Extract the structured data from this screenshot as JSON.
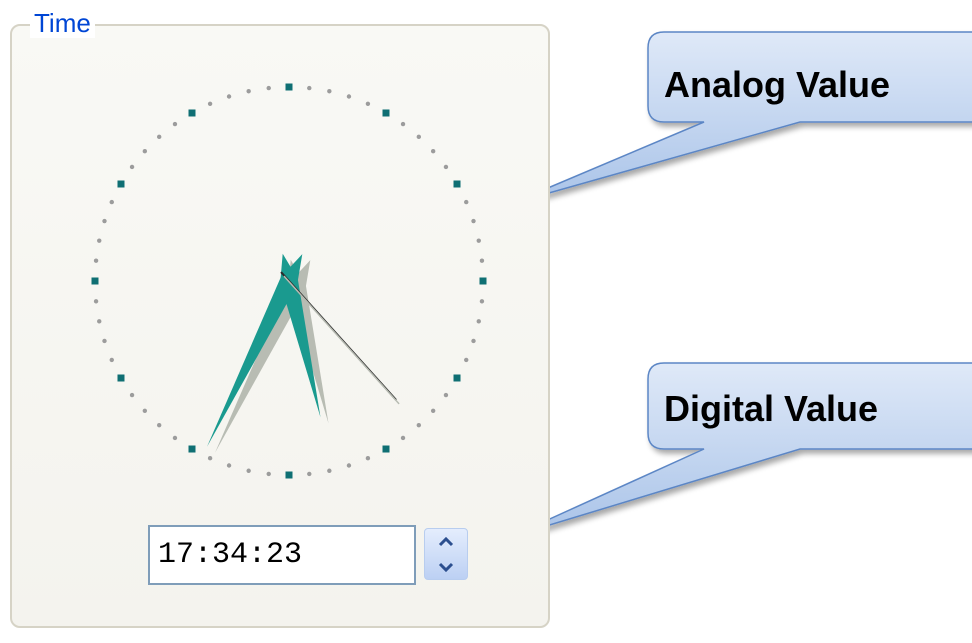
{
  "group": {
    "title": "Time"
  },
  "clock": {
    "hours": 17,
    "minutes": 34,
    "seconds": 23
  },
  "time_field": {
    "value": "17:34:23"
  },
  "callouts": {
    "analog": "Analog Value",
    "digital": "Digital Value"
  },
  "colors": {
    "hand_fill": "#1a9a8f",
    "hand_shadow": "#b8bcb3",
    "second_hand": "#2b2b2b",
    "tick_major": "#0f6f73",
    "tick_minor": "#9c9c9c",
    "group_title": "#0046d5",
    "callout_fill_top": "#dfe9f8",
    "callout_fill_bottom": "#a9c3e8",
    "callout_stroke": "#5b86c5"
  }
}
